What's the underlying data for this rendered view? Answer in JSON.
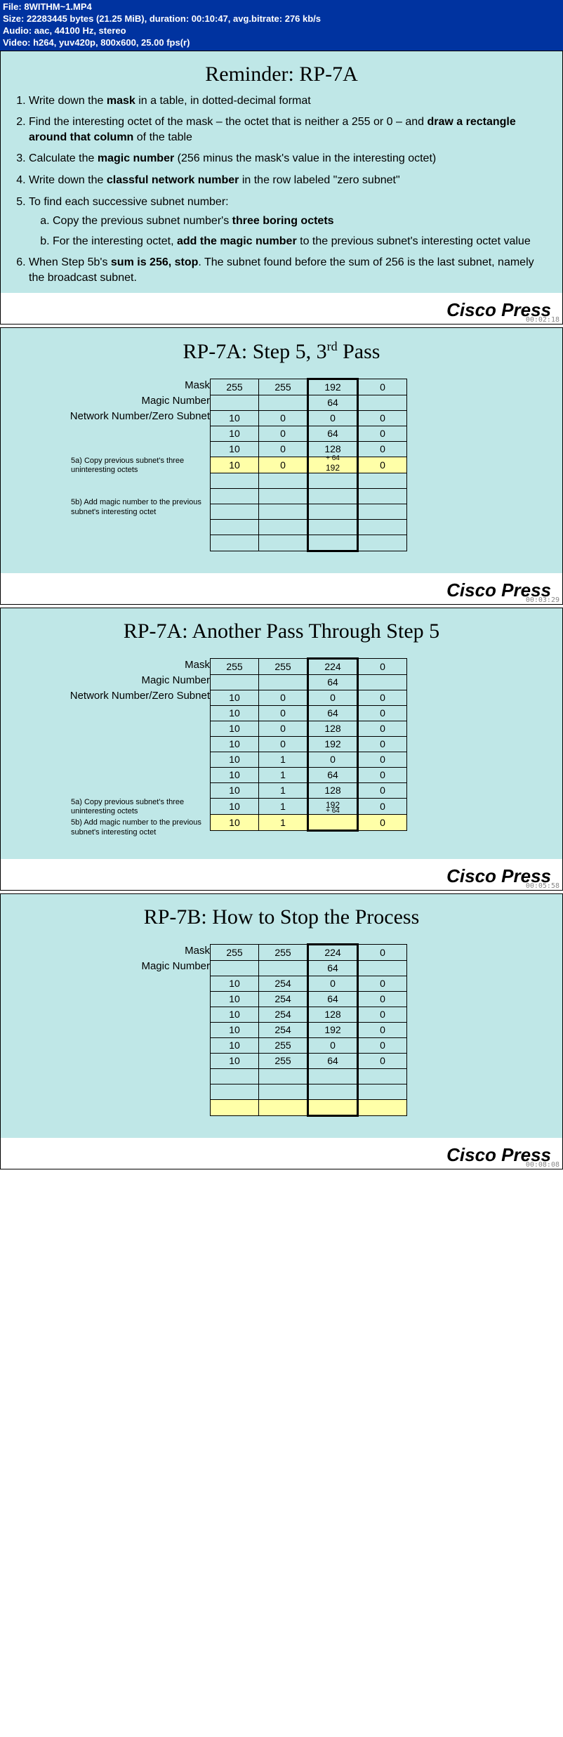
{
  "file": {
    "name": "File: 8WITHM~1.MP4",
    "size": "Size: 22283445 bytes (21.25 MiB), duration: 00:10:47, avg.bitrate: 276 kb/s",
    "audio": "Audio: aac, 44100 Hz, stereo",
    "video": "Video: h264, yuv420p, 800x600, 25.00 fps(r)"
  },
  "brand": "Cisco Press",
  "slide1": {
    "title": "Reminder: RP-7A",
    "li1a": "Write down the ",
    "li1b": "mask",
    "li1c": " in a table, in dotted-decimal format",
    "li2a": "Find the interesting octet of the mask – the octet that is neither a 255 or 0 – and ",
    "li2b": "draw a rectangle around that column",
    "li2c": " of the table",
    "li3a": "Calculate the ",
    "li3b": "magic number",
    "li3c": " (256 minus the mask's value in the interesting octet)",
    "li4a": "Write down the ",
    "li4b": "classful network number",
    "li4c": " in the row labeled \"zero subnet\"",
    "li5": "To find each successive subnet number:",
    "li5a1": "Copy the previous subnet number's ",
    "li5a2": "three boring octets",
    "li5b1": "For the interesting octet, ",
    "li5b2": "add the magic number",
    "li5b3": " to the previous subnet's interesting octet value",
    "li6a": "When Step 5b's ",
    "li6b": "sum is 256, stop",
    "li6c": ". The subnet found before the sum of 256 is the last subnet, namely the broadcast subnet.",
    "tstamp": "00:02:18"
  },
  "labels": {
    "mask": "Mask",
    "magic": "Magic Number",
    "zero": "Network Number/Zero Subnet",
    "n5a": "5a) Copy previous subnet's three uninteresting octets",
    "n5b": "5b) Add magic number to the previous subnet's interesting octet"
  },
  "slide2": {
    "title_a": "RP-7A: Step 5, 3",
    "title_b": "rd",
    "title_c": " Pass",
    "tstamp": "00:03:29",
    "add": "+ 64",
    "r1": [
      "255",
      "255",
      "192",
      "0"
    ],
    "r2": [
      "",
      "",
      "64",
      ""
    ],
    "r3": [
      "10",
      "0",
      "0",
      "0"
    ],
    "r4": [
      "10",
      "0",
      "64",
      "0"
    ],
    "r5": [
      "10",
      "0",
      "128",
      "0"
    ],
    "r6": [
      "10",
      "0",
      "192",
      "0"
    ]
  },
  "slide3": {
    "title": "RP-7A: Another Pass Through Step 5",
    "tstamp": "00:05:58",
    "add": "+ 64",
    "r1": [
      "255",
      "255",
      "224",
      "0"
    ],
    "r2": [
      "",
      "",
      "64",
      ""
    ],
    "r3": [
      "10",
      "0",
      "0",
      "0"
    ],
    "r4": [
      "10",
      "0",
      "64",
      "0"
    ],
    "r5": [
      "10",
      "0",
      "128",
      "0"
    ],
    "r6": [
      "10",
      "0",
      "192",
      "0"
    ],
    "r7": [
      "10",
      "1",
      "0",
      "0"
    ],
    "r8": [
      "10",
      "1",
      "64",
      "0"
    ],
    "r9": [
      "10",
      "1",
      "128",
      "0"
    ],
    "r10": [
      "10",
      "1",
      "192",
      "0"
    ],
    "r11": [
      "10",
      "1",
      "",
      "0"
    ]
  },
  "slide4": {
    "title": "RP-7B: How to Stop the Process",
    "tstamp": "00:08:08",
    "r1": [
      "255",
      "255",
      "224",
      "0"
    ],
    "r2": [
      "",
      "",
      "64",
      ""
    ],
    "r3": [
      "10",
      "254",
      "0",
      "0"
    ],
    "r4": [
      "10",
      "254",
      "64",
      "0"
    ],
    "r5": [
      "10",
      "254",
      "128",
      "0"
    ],
    "r6": [
      "10",
      "254",
      "192",
      "0"
    ],
    "r7": [
      "10",
      "255",
      "0",
      "0"
    ],
    "r8": [
      "10",
      "255",
      "64",
      "0"
    ]
  }
}
